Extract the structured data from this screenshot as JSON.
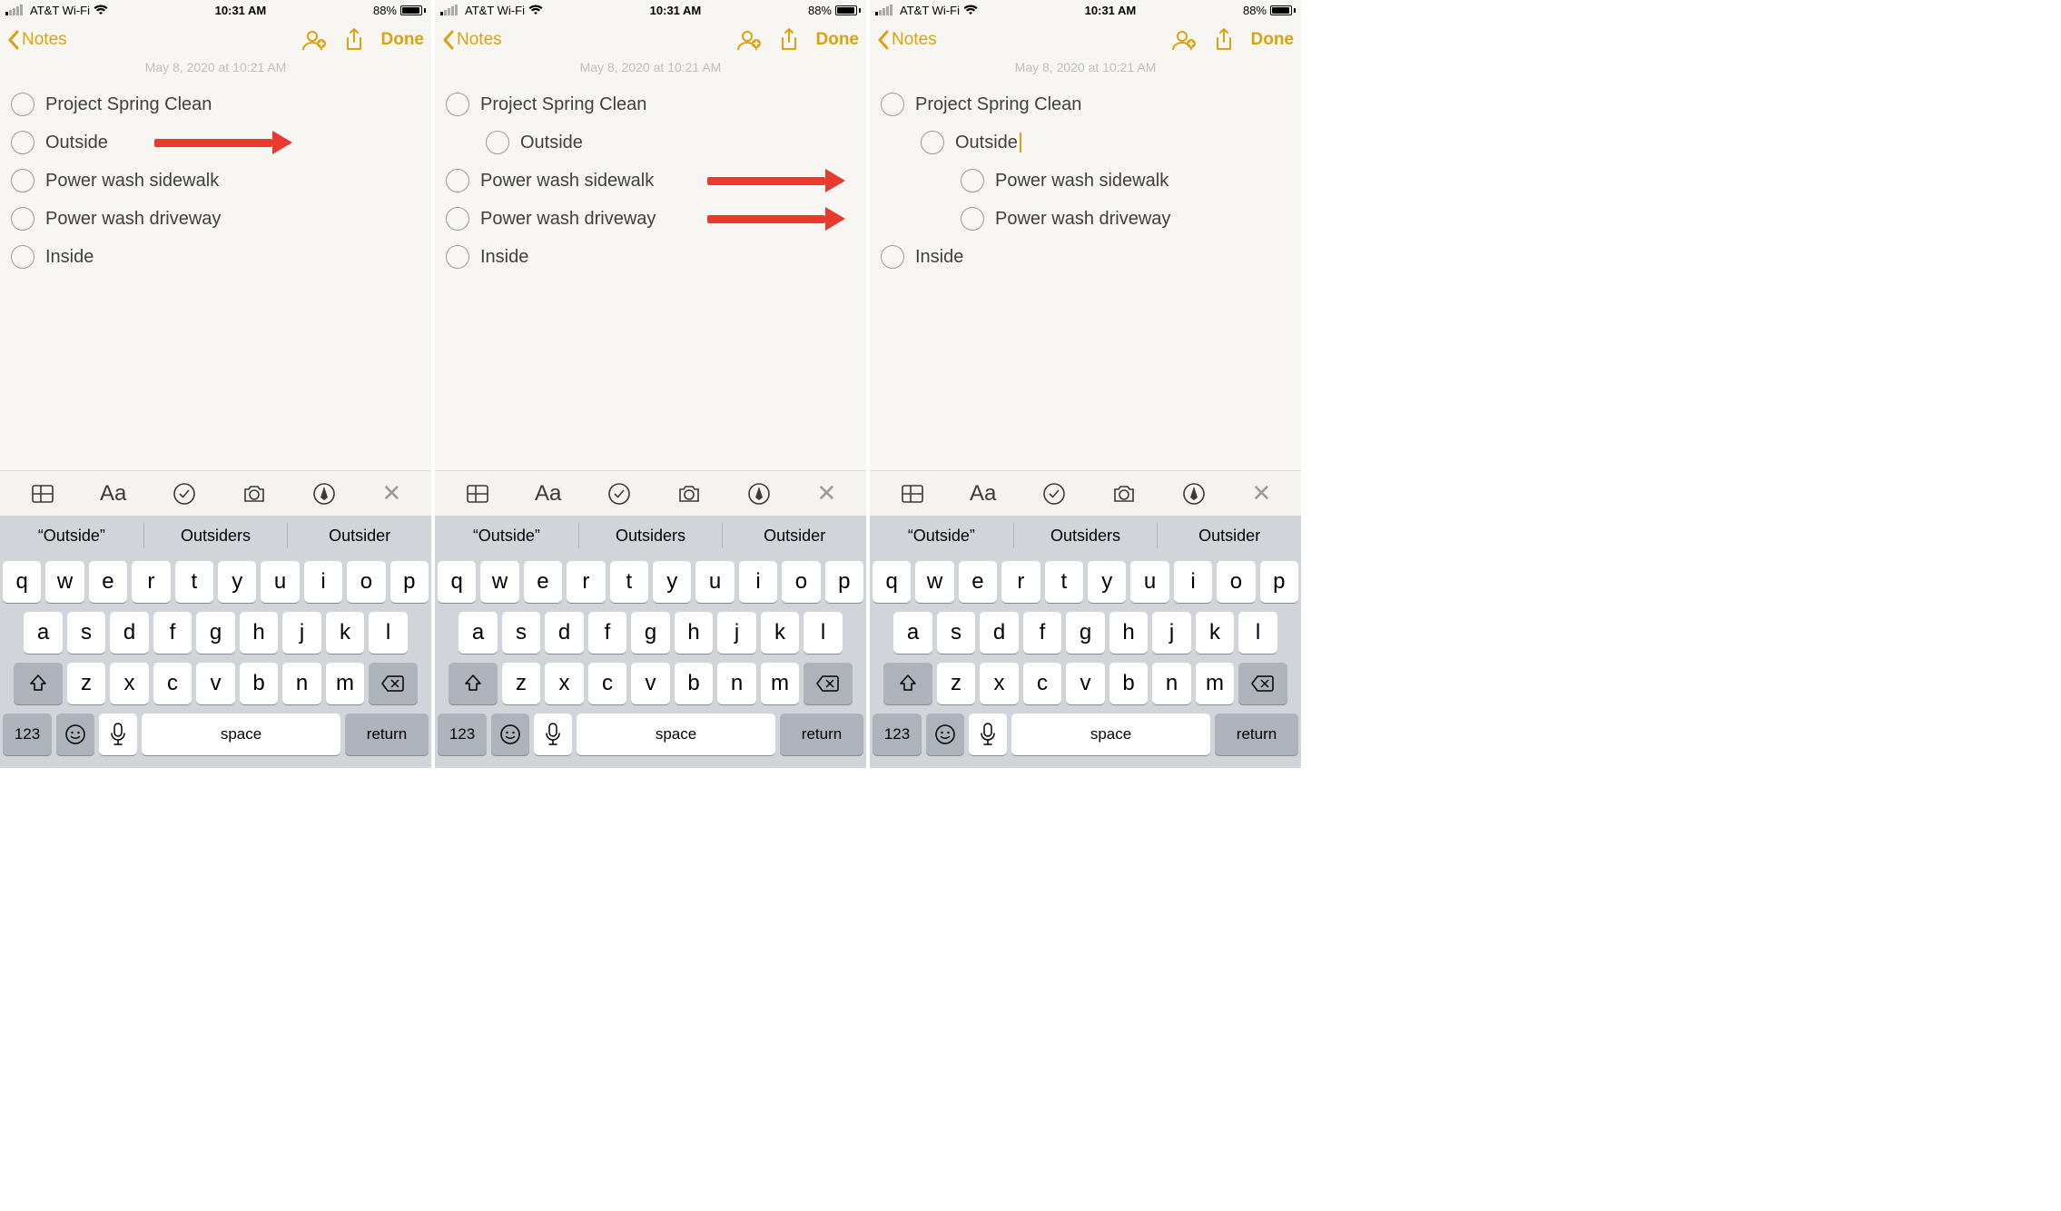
{
  "status": {
    "carrier": "AT&T Wi-Fi",
    "time": "10:31 AM",
    "battery": "88%"
  },
  "nav": {
    "back_label": "Notes",
    "done_label": "Done",
    "ghost_date": "May 8, 2020 at 10:21 AM"
  },
  "screens": [
    {
      "items": [
        {
          "text": "Project Spring Clean",
          "indent": 0
        },
        {
          "text": "Outside",
          "indent": 0,
          "arrow": true
        },
        {
          "text": "Power wash sidewalk",
          "indent": 0
        },
        {
          "text": "Power wash driveway",
          "indent": 0
        },
        {
          "text": "Inside",
          "indent": 0
        }
      ]
    },
    {
      "items": [
        {
          "text": "Project Spring Clean",
          "indent": 0
        },
        {
          "text": "Outside",
          "indent": 1
        },
        {
          "text": "Power wash sidewalk",
          "indent": 0,
          "arrow": true
        },
        {
          "text": "Power wash driveway",
          "indent": 0,
          "arrow": true
        },
        {
          "text": "Inside",
          "indent": 0
        }
      ]
    },
    {
      "items": [
        {
          "text": "Project Spring Clean",
          "indent": 0
        },
        {
          "text": "Outside",
          "indent": 1,
          "cursor": true
        },
        {
          "text": "Power wash sidewalk",
          "indent": 2
        },
        {
          "text": "Power wash driveway",
          "indent": 2
        },
        {
          "text": "Inside",
          "indent": 0
        }
      ]
    }
  ],
  "suggestions": [
    "“Outside”",
    "Outsiders",
    "Outsider"
  ],
  "keyboard": {
    "row1": [
      "q",
      "w",
      "e",
      "r",
      "t",
      "y",
      "u",
      "i",
      "o",
      "p"
    ],
    "row2": [
      "a",
      "s",
      "d",
      "f",
      "g",
      "h",
      "j",
      "k",
      "l"
    ],
    "row3": [
      "z",
      "x",
      "c",
      "v",
      "b",
      "n",
      "m"
    ],
    "num": "123",
    "space": "space",
    "return": "return"
  }
}
